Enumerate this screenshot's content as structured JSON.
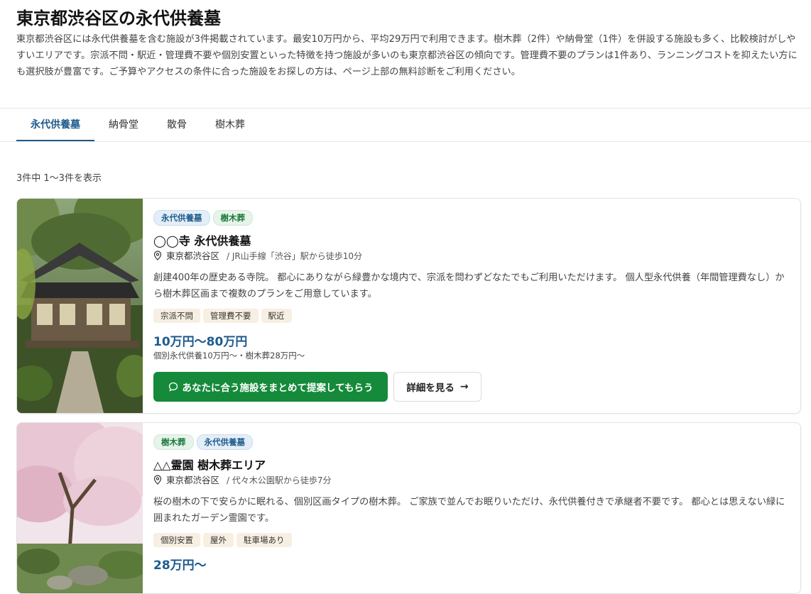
{
  "page": {
    "title": "東京都渋谷区の永代供養墓",
    "intro": "東京都渋谷区には永代供養墓を含む施設が3件掲載されています。最安10万円から、平均29万円で利用できます。樹木葬（2件）や納骨堂（1件）を併設する施設も多く、比較検討がしやすいエリアです。宗派不問・駅近・管理費不要や個別安置といった特徴を持つ施設が多いのも東京都渋谷区の傾向です。管理費不要のプランは1件あり、ランニングコストを抑えたい方にも選択肢が豊富です。ご予算やアクセスの条件に合った施設をお探しの方は、ページ上部の無料診断をご利用ください。"
  },
  "tabs": [
    {
      "label": "永代供養墓"
    },
    {
      "label": "納骨堂"
    },
    {
      "label": "散骨"
    },
    {
      "label": "樹木葬"
    }
  ],
  "results_count": "3件中 1〜3件を表示",
  "colors": {
    "accent": "#1f5b8c",
    "cta": "#158a3a",
    "feature_bg": "#f7efe1"
  },
  "cards": [
    {
      "tags": [
        "永代供養墓",
        "樹木葬"
      ],
      "name": "◯◯寺 永代供養墓",
      "location": "東京都渋谷区",
      "access": "/ JR山手線「渋谷」駅から徒歩10分",
      "description": "創建400年の歴史ある寺院。 都心にありながら緑豊かな境内で、宗派を問わずどなたでもご利用いただけます。 個人型永代供養（年間管理費なし）から樹木葬区画まで複数のプランをご用意しています。",
      "features": [
        "宗派不問",
        "管理費不要",
        "駅近"
      ],
      "price": "10万円〜80万円",
      "price_detail": "個別永代供養10万円〜・樹木葬28万円〜",
      "cta_label": "あなたに合う施設をまとめて提案してもらう",
      "detail_label": "詳細を見る",
      "image_icon": "temple-photo"
    },
    {
      "tags": [
        "樹木葬",
        "永代供養墓"
      ],
      "name": "△△霊園 樹木葬エリア",
      "location": "東京都渋谷区",
      "access": "/ 代々木公園駅から徒歩7分",
      "description": "桜の樹木の下で安らかに眠れる、個別区画タイプの樹木葬。 ご家族で並んでお眠りいただけ、永代供養付きで承継者不要です。 都心とは思えない緑に囲まれたガーデン霊園です。",
      "features": [
        "個別安置",
        "屋外",
        "駐車場あり"
      ],
      "price": "28万円〜",
      "image_icon": "cherry-blossom-photo"
    }
  ]
}
